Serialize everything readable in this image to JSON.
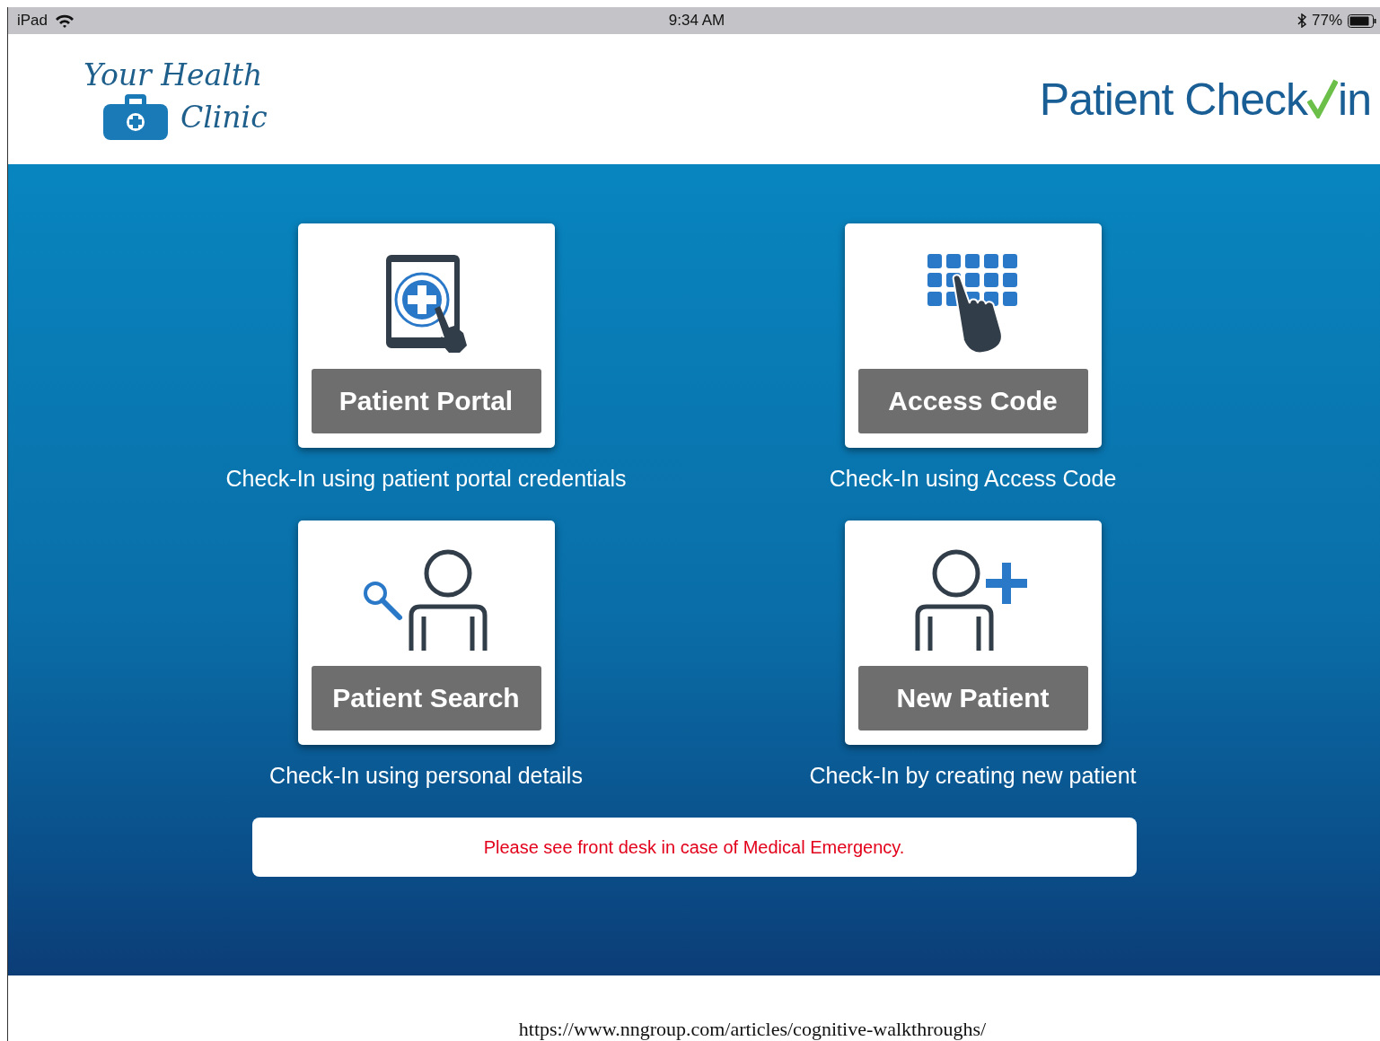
{
  "status_bar": {
    "device": "iPad",
    "time": "9:34 AM",
    "battery": "77%"
  },
  "header": {
    "logo_line_1": "Your Health",
    "logo_line_2": "Clinic",
    "title_before": "Patient Check",
    "title_after": "in"
  },
  "options": [
    {
      "kind": "tablet",
      "label": "Patient Portal",
      "description": "Check-In using patient portal credentials"
    },
    {
      "kind": "keypad",
      "label": "Access Code",
      "description": "Check-In using Access Code"
    },
    {
      "kind": "search-person",
      "label": "Patient Search",
      "description": "Check-In using personal details"
    },
    {
      "kind": "add-person",
      "label": "New Patient",
      "description": "Check-In by creating new patient"
    }
  ],
  "notice": "Please see front desk in case of Medical Emergency.",
  "source_caption": "https://www.nngroup.com/articles/cognitive-walkthroughs/"
}
